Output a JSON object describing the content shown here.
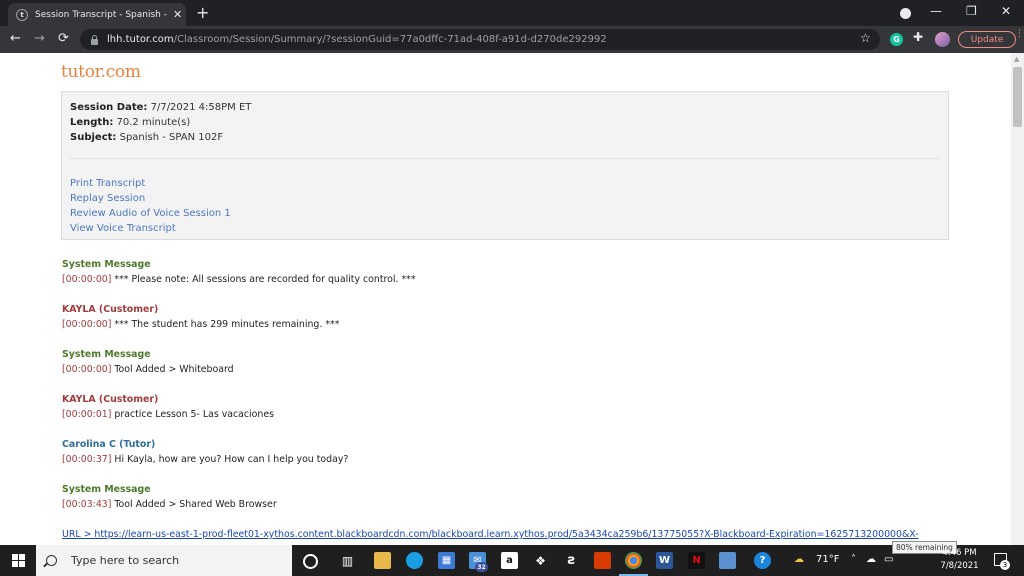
{
  "browser": {
    "tab_title": "Session Transcript - Spanish - SPAN",
    "tab_close": "✕",
    "new_tab": "+",
    "minimize": "—",
    "restore": "❐",
    "close": "✕",
    "back": "←",
    "forward": "→",
    "reload": "⟳",
    "url_host": "lhh.tutor.com",
    "url_path": "/Classroom/Session/Summary/?sessionGuid=77a0dffc-71ad-408f-a91d-d270de292992",
    "bookmark": "☆",
    "extension_g": "G",
    "extensions": "✚",
    "update_label": "Update",
    "menu": "⋮"
  },
  "page": {
    "logo": "tutor.com",
    "session": {
      "date_label": "Session Date:",
      "date_value": "7/7/2021 4:58PM ET",
      "length_label": "Length:",
      "length_value": "70.2 minute(s)",
      "subject_label": "Subject:",
      "subject_value": "Spanish - SPAN 102F"
    },
    "links": [
      "Print Transcript",
      "Replay Session",
      "Review Audio of Voice Session 1",
      "View Voice Transcript"
    ],
    "messages": [
      {
        "sender": "System Message",
        "role": "system",
        "time": "[00:00:00]",
        "text": "*** Please note: All sessions are recorded for quality control. ***"
      },
      {
        "sender": "KAYLA (Customer)",
        "role": "customer",
        "time": "[00:00:00]",
        "text": "*** The student has 299 minutes remaining. ***"
      },
      {
        "sender": "System Message",
        "role": "system",
        "time": "[00:00:00]",
        "text": "Tool Added > Whiteboard"
      },
      {
        "sender": "KAYLA (Customer)",
        "role": "customer",
        "time": "[00:00:01]",
        "text": "practice Lesson 5- Las vacaciones"
      },
      {
        "sender": "Carolina C (Tutor)",
        "role": "tutor",
        "time": "[00:00:37]",
        "text": "Hi Kayla, how are you? How can I help you today?"
      },
      {
        "sender": "System Message",
        "role": "system",
        "time": "[00:03:43]",
        "text": "Tool Added > Shared Web Browser"
      }
    ],
    "url_line": "URL      >      https://learn-us-east-1-prod-fleet01-xythos.content.blackboardcdn.com/blackboard.learn.xythos.prod/5a3434ca259b6/13775055?X-Blackboard-Expiration=1625713200000&X-"
  },
  "taskbar": {
    "search_placeholder": "Type here to search",
    "mail_badge": "32",
    "amazon": "a",
    "netflix": "N",
    "word": "W",
    "help": "?",
    "temperature": "71°F",
    "tooltip": "80% remaining",
    "time": "4:46 PM",
    "date": "7/8/2021",
    "notifications_count": "3"
  },
  "colors": {
    "logo": "#e8823a",
    "system": "#4b7a2b",
    "customer": "#a33b3b",
    "tutor": "#2e6e9e",
    "link": "#4a78c2",
    "update": "#f28b82"
  }
}
